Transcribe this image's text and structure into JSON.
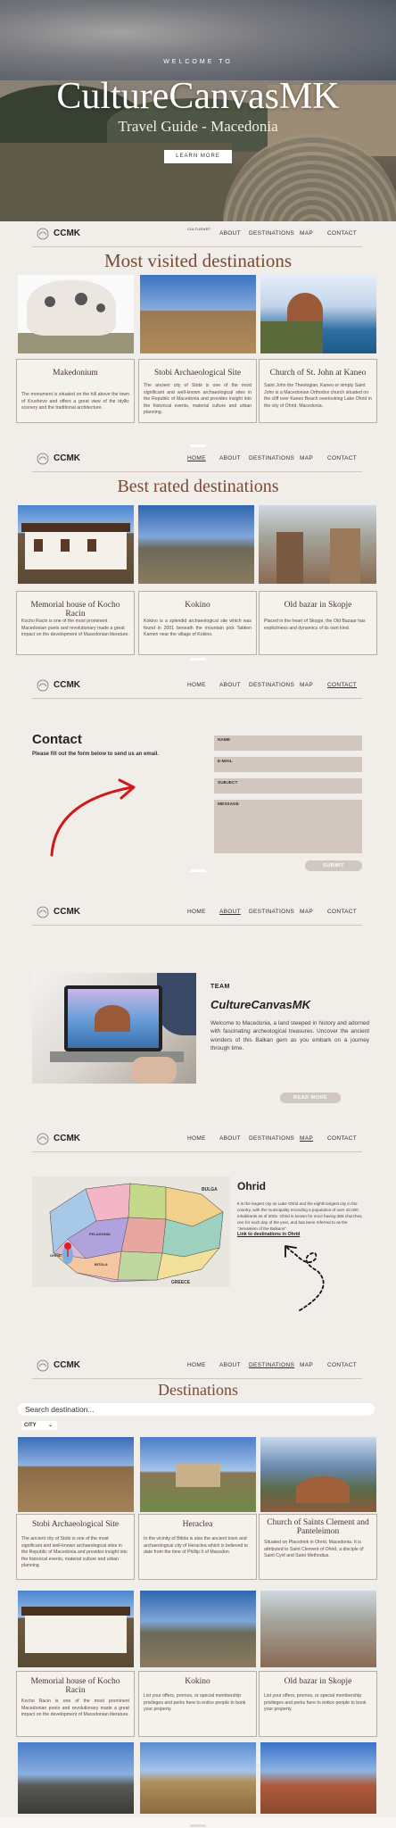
{
  "hero": {
    "welcome": "WELCOME TO",
    "title": "CultureCanvasMK",
    "subtitle": "Travel Guide - Macedonia",
    "button": "LEARN MORE"
  },
  "nav": {
    "brand": "CCMK",
    "home": "HOME",
    "about": "ABOUT",
    "destinations": "DESTINATIONS",
    "map": "MAP",
    "contact": "CONTACT",
    "home_small": "CULTURART"
  },
  "most_visited": {
    "title": "Most visited destinations",
    "cards": [
      {
        "title": "Makedonium",
        "desc": "The monument is situated on the hill above the town of Krushevo and offers a great view of the idyllic scenery and the traditional architecture."
      },
      {
        "title": "Stobi Archaeological Site",
        "desc": "The ancient city of Stobi is one of the most significant and well-known archaeological sites in the Republic of Macedonia and provides insight into the historical events, material culture and urban planning."
      },
      {
        "title": "Church of St. John at Kaneo",
        "desc": "Saint John the Theologian, Kaneo or simply Saint John is a Macedonian Orthodox church situated on the cliff over Kaneo Beach overlooking Lake Ohrid in the city of Ohrid, Macedonia."
      }
    ]
  },
  "best_rated": {
    "title": "Best rated destinations",
    "cards": [
      {
        "title": "Memorial house of Kocho Racin",
        "desc": "Kocho Racin is one of the most prominent Macedonian poets and revolutionary made a great impact on the development of Macedonian literature."
      },
      {
        "title": "Kokino",
        "desc": "Kokino is a splendid archaeological site which was found in 2001 beneath the mountain pick Tatiken Kamen near the village of Kokino."
      },
      {
        "title": "Old bazar in Skopje",
        "desc": "Placed in the heart of Skopje, the Old Bazaar has explicitness and dynamics of its own kind."
      }
    ]
  },
  "contact": {
    "title": "Contact",
    "subtitle": "Please fill out the form below to send us an email.",
    "fields": [
      "NAME",
      "E-MAIL",
      "SUBJECT",
      "MESSAGE"
    ],
    "submit": "SUBMIT"
  },
  "about": {
    "label": "TEAM",
    "name": "CultureCanvasMK",
    "desc": "Welcome to Macedonia, a land steeped in history and adorned with fascinating archeological treasures. Uncover the ancient wonders of this Balkan gem as you embark on a journey through time.",
    "button": "READ MORE"
  },
  "map_section": {
    "city": "Ohrid",
    "desc": "It is the largest city on Lake Ohrid and the eighth-largest city in the country, with the municipality recording a population of over 42,000 inhabitants as of 2002. Ohrid is known for once having 365 churches, one for each day of the year, and has been referred to as the \"Jerusalem of the Balkans\".",
    "link": "Link to destinations in Ohrid",
    "map_labels": [
      "BULGA",
      "GREECE",
      "OHRID",
      "PELAGONIA",
      "BITOLA"
    ]
  },
  "destinations": {
    "title": "Destinations",
    "search_placeholder": "Search destination...",
    "filter": "CITY",
    "cards": [
      {
        "title": "Stobi Archaeological Site",
        "desc": "The ancient city of Stobi is one of the most significant and well-known archaeological sites in the Republic of Macedonia and provides insight into the historical events, material culture and urban planning."
      },
      {
        "title": "Heraclea",
        "desc": "In the vicinity of Bitola is also the ancient town and archaeological city of Heraclea which is believed to date from the time of Phillip II of Macedon"
      },
      {
        "title": "Church of Saints Clement and Panteleimon",
        "desc": "Situated on Plaoshnik in Ohrid, Macedonia. It is attributed to Saint Clement of Ohrid, a disciple of Saint Cyril and Saint Methodius."
      },
      {
        "title": "Memorial house of Kocho Racin",
        "desc": "Kocho Racin is one of the most prominent Macedonian poets and revolutionary made a great impact on the development of Macedonian literature."
      },
      {
        "title": "Kokino",
        "desc": "List your offers, promos, or special membership privileges and perks here to entice people to book your property."
      },
      {
        "title": "Old bazar in Skopje",
        "desc": "List your offers, promos, or special membership privileges and perks here to entice people to book your property."
      }
    ]
  },
  "colors": {
    "accent": "#7a4a36",
    "field": "#d2c7bf",
    "background": "#f1eeea",
    "arrow": "#d01818"
  }
}
